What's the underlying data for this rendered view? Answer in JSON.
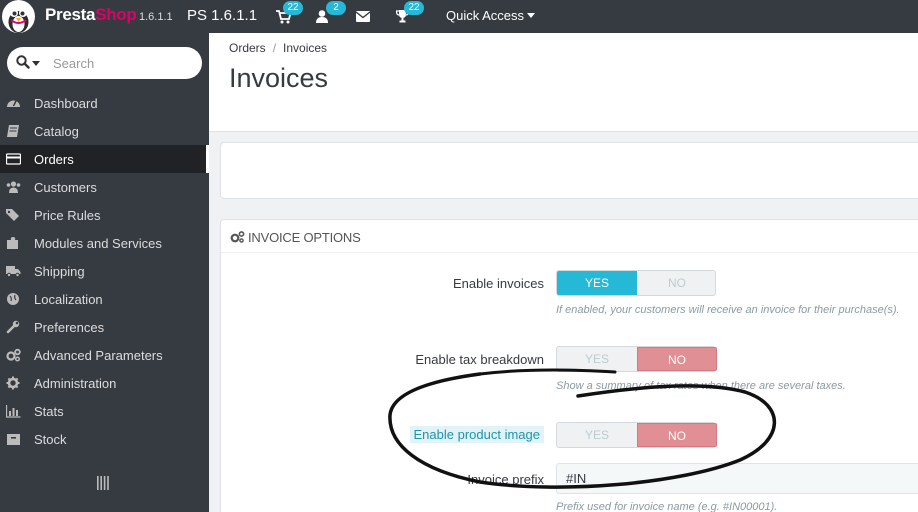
{
  "topbar": {
    "brand_part1": "Presta",
    "brand_part2": "Shop",
    "version_small": "1.6.1.1",
    "version_big": "PS 1.6.1.1",
    "cart_count": "22",
    "customers_count": "2",
    "trophy_count": "22",
    "quick_access": "Quick Access",
    "colors": {
      "bar": "#363a41",
      "badge": "#25b9d7",
      "brand_accent": "#df0067"
    }
  },
  "sidebar": {
    "search_placeholder": "Search",
    "items": [
      {
        "label": "Dashboard",
        "icon": "dashboard-icon"
      },
      {
        "label": "Catalog",
        "icon": "book-icon"
      },
      {
        "label": "Orders",
        "icon": "credit-card-icon",
        "active": true
      },
      {
        "label": "Customers",
        "icon": "users-icon"
      },
      {
        "label": "Price Rules",
        "icon": "tags-icon"
      },
      {
        "label": "Modules and Services",
        "icon": "puzzle-icon"
      },
      {
        "label": "Shipping",
        "icon": "truck-icon"
      },
      {
        "label": "Localization",
        "icon": "globe-icon"
      },
      {
        "label": "Preferences",
        "icon": "wrench-icon"
      },
      {
        "label": "Advanced Parameters",
        "icon": "cogs-icon"
      },
      {
        "label": "Administration",
        "icon": "gear-icon"
      },
      {
        "label": "Stats",
        "icon": "bar-chart-icon"
      },
      {
        "label": "Stock",
        "icon": "archive-icon"
      }
    ]
  },
  "header": {
    "breadcrumb": [
      "Orders",
      "Invoices"
    ],
    "title": "Invoices"
  },
  "invoice_options": {
    "title": "INVOICE OPTIONS",
    "fields": [
      {
        "label": "Enable invoices",
        "yes": "YES",
        "no": "NO",
        "value": "YES",
        "help": "If enabled, your customers will receive an invoice for their purchase(s)."
      },
      {
        "label": "Enable tax breakdown",
        "yes": "YES",
        "no": "NO",
        "value": "NO",
        "help": "Show a summary of tax rates when there are several taxes."
      },
      {
        "label": "Enable product image",
        "yes": "YES",
        "no": "NO",
        "value": "NO"
      }
    ],
    "prefix": {
      "label": "Invoice prefix",
      "value": "#IN",
      "help": "Prefix used for invoice name (e.g. #IN00001)."
    },
    "colors": {
      "yes_on": "#25b9d7",
      "no_on": "#e08f95"
    }
  }
}
